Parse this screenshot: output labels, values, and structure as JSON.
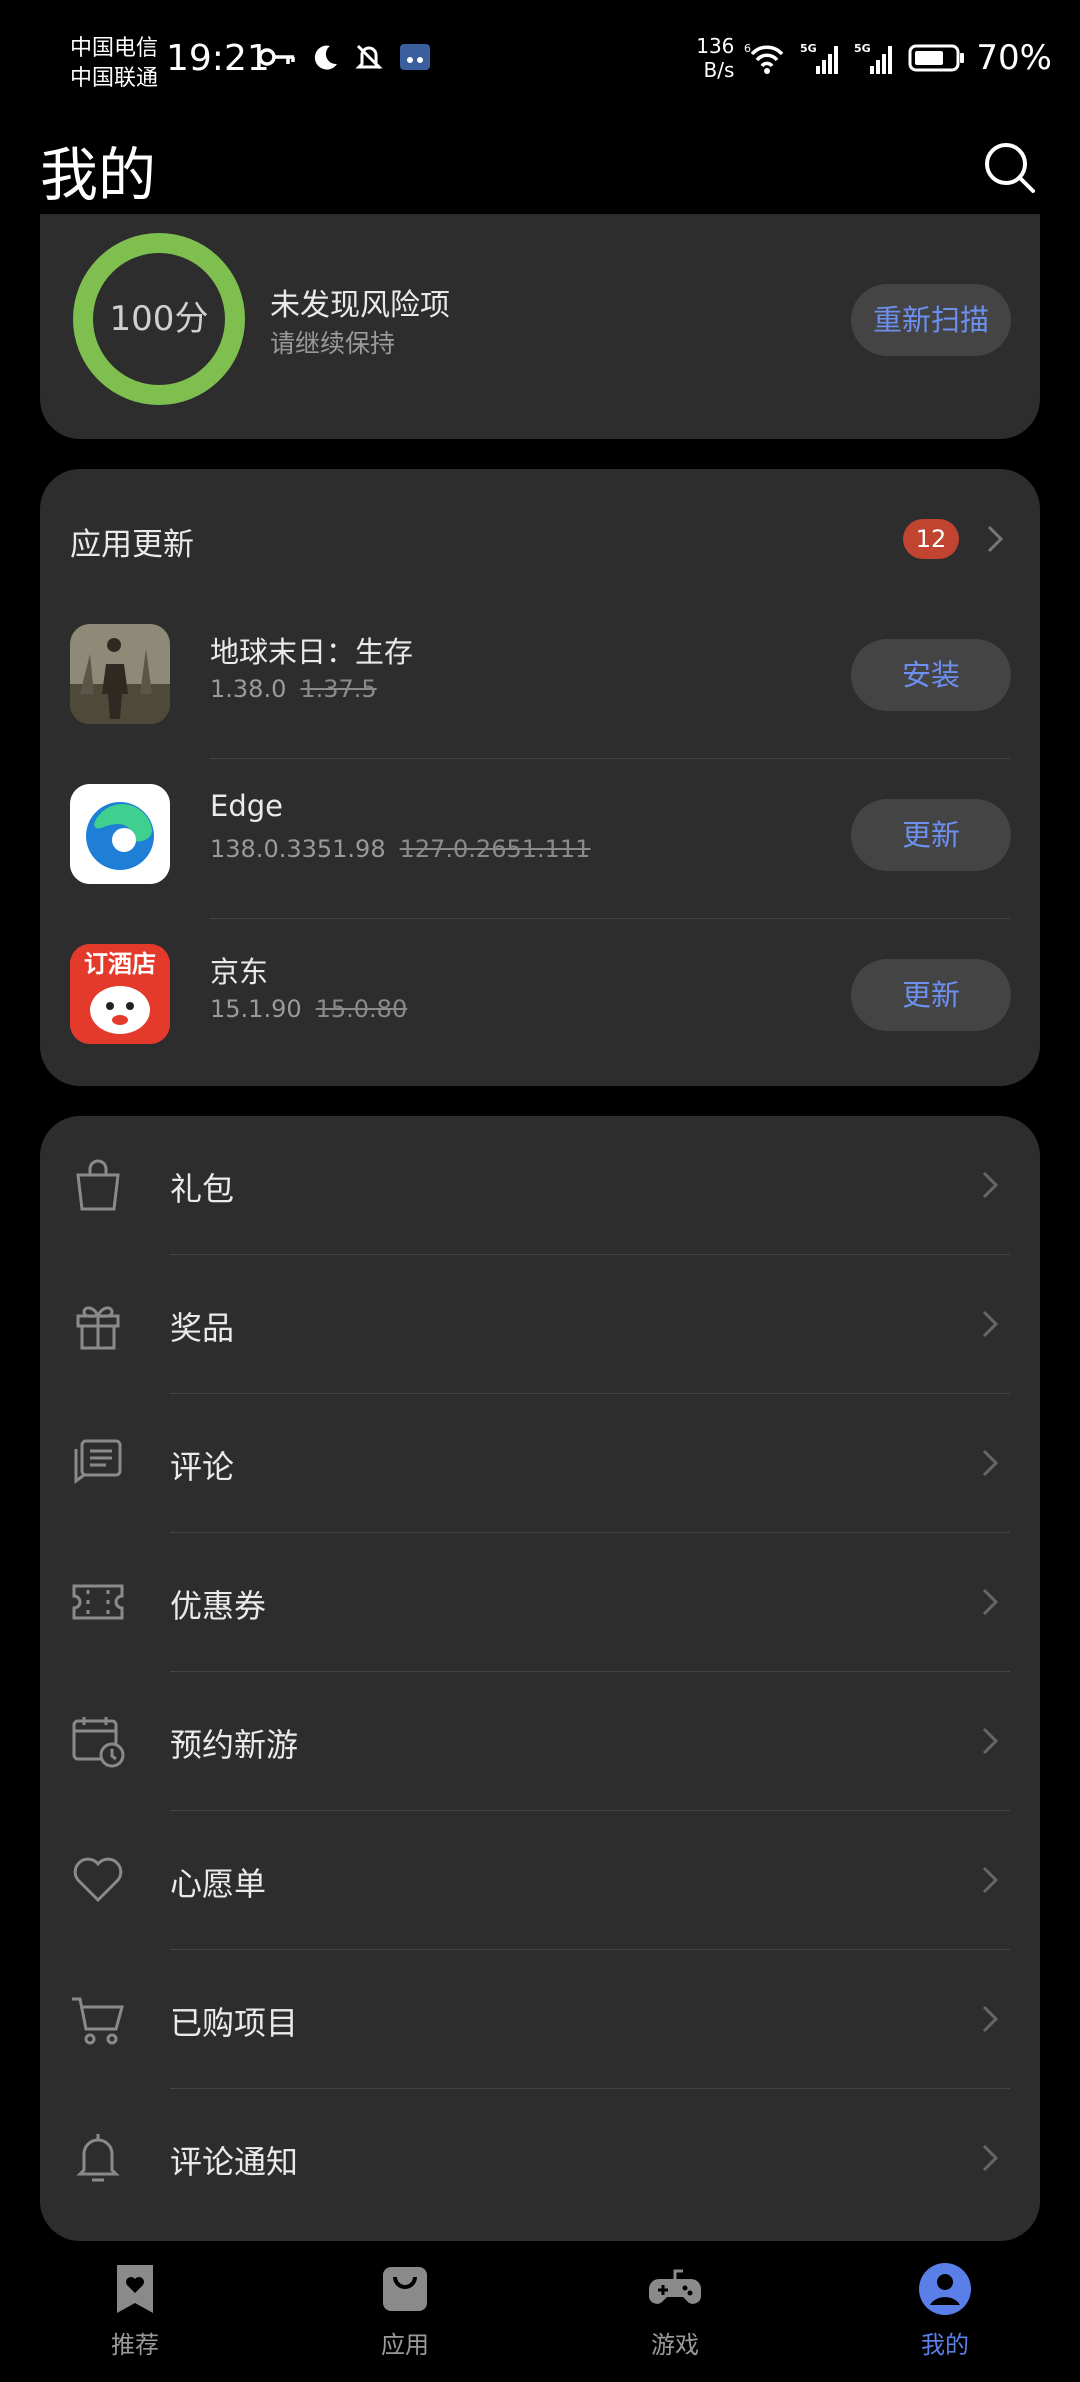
{
  "status_bar": {
    "carrier_1": "中国电信",
    "carrier_2": "中国联通",
    "time": "19:21",
    "net_speed_value": "136",
    "net_speed_unit": "B/s",
    "signal_1": "5G",
    "signal_2": "5G",
    "wifi_label": "6",
    "battery": "70%"
  },
  "header": {
    "title": "我的"
  },
  "security": {
    "score": "100分",
    "title": "未发现风险项",
    "subtitle": "请继续保持",
    "rescan_label": "重新扫描"
  },
  "updates": {
    "title": "应用更新",
    "count": "12",
    "apps": [
      {
        "name": "地球末日：生存",
        "new_version": "1.38.0",
        "old_version": "1.37.5",
        "action": "安装"
      },
      {
        "name": "Edge",
        "new_version": "138.0.3351.98",
        "old_version": "127.0.2651.111",
        "action": "更新"
      },
      {
        "name": "京东",
        "new_version": "15.1.90",
        "old_version": "15.0.80",
        "action": "更新",
        "icon_text": "订酒店"
      }
    ]
  },
  "menu": [
    {
      "label": "礼包",
      "icon": "gift-bag-icon"
    },
    {
      "label": "奖品",
      "icon": "gift-box-icon"
    },
    {
      "label": "评论",
      "icon": "comment-icon"
    },
    {
      "label": "优惠券",
      "icon": "coupon-icon"
    },
    {
      "label": "预约新游",
      "icon": "calendar-clock-icon"
    },
    {
      "label": "心愿单",
      "icon": "heart-icon"
    },
    {
      "label": "已购项目",
      "icon": "cart-icon"
    },
    {
      "label": "评论通知",
      "icon": "bell-icon"
    }
  ],
  "bottom_nav": [
    {
      "label": "推荐",
      "icon": "bookmark-heart-icon",
      "active": false
    },
    {
      "label": "应用",
      "icon": "shopping-bag-icon",
      "active": false
    },
    {
      "label": "游戏",
      "icon": "gamepad-icon",
      "active": false
    },
    {
      "label": "我的",
      "icon": "user-icon",
      "active": true
    }
  ],
  "colors": {
    "accent": "#5b7fe8",
    "ring": "#7fbf4f",
    "badge": "#c0442f",
    "card": "#2d2d2d"
  }
}
